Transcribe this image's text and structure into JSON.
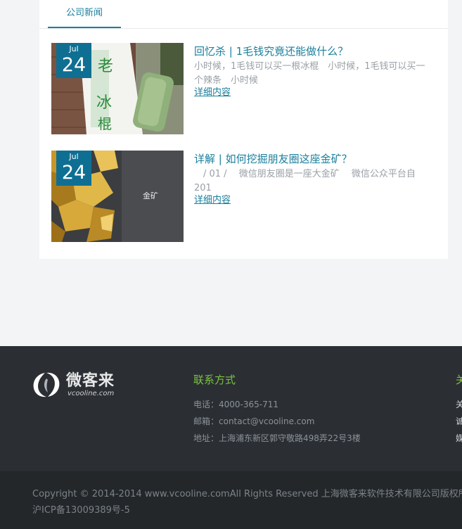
{
  "tabs": [
    {
      "label": "公司新闻",
      "active": true
    }
  ],
  "articles": [
    {
      "date_month": "Jul",
      "date_day": "24",
      "title": "回忆杀 | 1毛钱究竟还能做什么？",
      "summary": "小时候，1毛钱可以买一根冰棍　小时候，1毛钱可以买一个辣条　小时候",
      "more_label": "详细内容",
      "image": "popsicle-photo"
    },
    {
      "date_month": "Jul",
      "date_day": "24",
      "title": "详解 | 如何挖掘朋友圈这座金矿？",
      "summary": "　/ 01 /　 微信朋友圈是一座大金矿　 微信公众平台自201",
      "more_label": "详细内容",
      "image": "gold-nuggets-photo",
      "image_caption": "金矿"
    }
  ],
  "footer": {
    "logo": {
      "name": "微客来",
      "url": "vcooline.com"
    },
    "contact": {
      "title": "联系方式",
      "phone": "电话：4000-365-711",
      "email": "邮箱：contact@vcooline.com",
      "address": "地址：上海浦东新区郭守敬路498弄22号3楼"
    },
    "col3": {
      "title_partial": "关",
      "lines_partial": [
        "关",
        "诚",
        "媒"
      ]
    },
    "copyright": "Copyright © 2014-2014 www.vcooline.comAll Rights Reserved 上海微客来软件技术有限公司版权所有",
    "icp": "沪ICP备13009389号-5"
  },
  "colors": {
    "accent": "#1a7f9c",
    "date_badge": "#0f6f93",
    "footer_bg": "#2b2f33",
    "footer_title": "#7cc142",
    "bottom_bg": "#23272a"
  }
}
